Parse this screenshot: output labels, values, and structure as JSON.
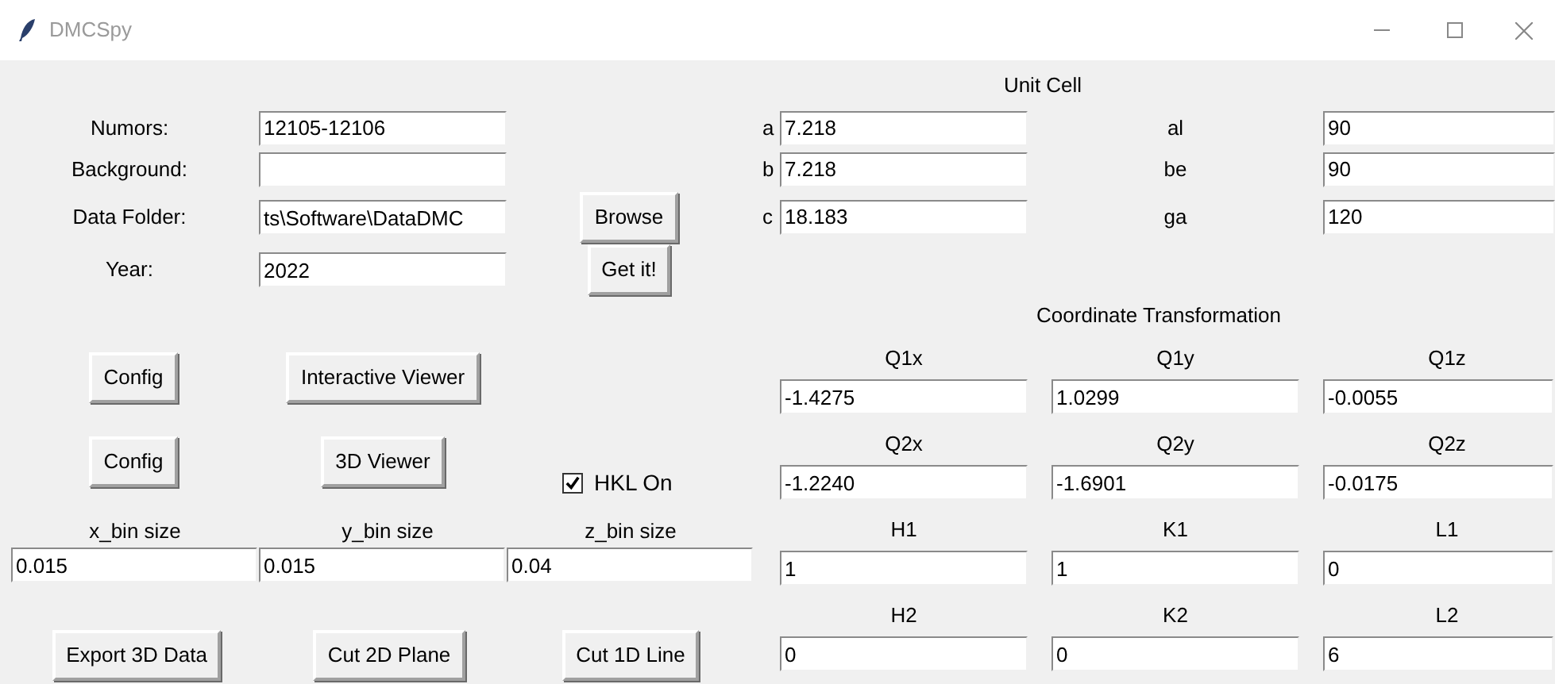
{
  "window": {
    "title": "DMCSpy"
  },
  "file_fields": [
    {
      "label": "Numors:",
      "value": "12105-12106"
    },
    {
      "label": "Background:"
    },
    {
      "label": "Data Folder:",
      "value": "ts\\Software\\DataDMC"
    },
    {
      "label": "Year:",
      "value": "2022"
    }
  ],
  "browse_button": "Browse",
  "get_button": "Get it!",
  "viewer_rows": [
    [
      "Config",
      "Interactive Viewer"
    ],
    [
      "Config",
      "3D Viewer"
    ]
  ],
  "hkl_checkbox": {
    "label": "HKL On",
    "checked": true
  },
  "bin_sizes": [
    {
      "label": "x_bin size",
      "value": "0.015"
    },
    {
      "label": "y_bin size",
      "value": "0.015"
    },
    {
      "label": "z_bin size",
      "value": "0.04"
    }
  ],
  "actions": [
    "Export 3D Data",
    "Cut 2D Plane",
    "Cut 1D Line"
  ],
  "unit_cell": {
    "title": "Unit Cell",
    "rows": [
      {
        "length_label": "a",
        "length": "7.218",
        "angle_label": "al",
        "angle": "90"
      },
      {
        "length_label": "b",
        "length": "7.218",
        "angle_label": "be",
        "angle": "90"
      },
      {
        "length_label": "c",
        "length": "18.183",
        "angle_label": "ga",
        "angle": "120"
      }
    ]
  },
  "coordinate_transformation": {
    "title": "Coordinate Transformation",
    "rows": [
      [
        {
          "label": "Q1x",
          "value": "-1.4275"
        },
        {
          "label": "Q1y",
          "value": "1.0299"
        },
        {
          "label": "Q1z",
          "value": "-0.0055"
        }
      ],
      [
        {
          "label": "Q2x",
          "value": "-1.2240"
        },
        {
          "label": "Q2y",
          "value": "-1.6901"
        },
        {
          "label": "Q2z",
          "value": "-0.0175"
        }
      ],
      [
        {
          "label": "H1",
          "value": "1"
        },
        {
          "label": "K1",
          "value": "1"
        },
        {
          "label": "L1",
          "value": "0"
        }
      ],
      [
        {
          "label": "H2",
          "value": "0"
        },
        {
          "label": "K2",
          "value": "0"
        },
        {
          "label": "L2",
          "value": "6"
        }
      ]
    ]
  }
}
